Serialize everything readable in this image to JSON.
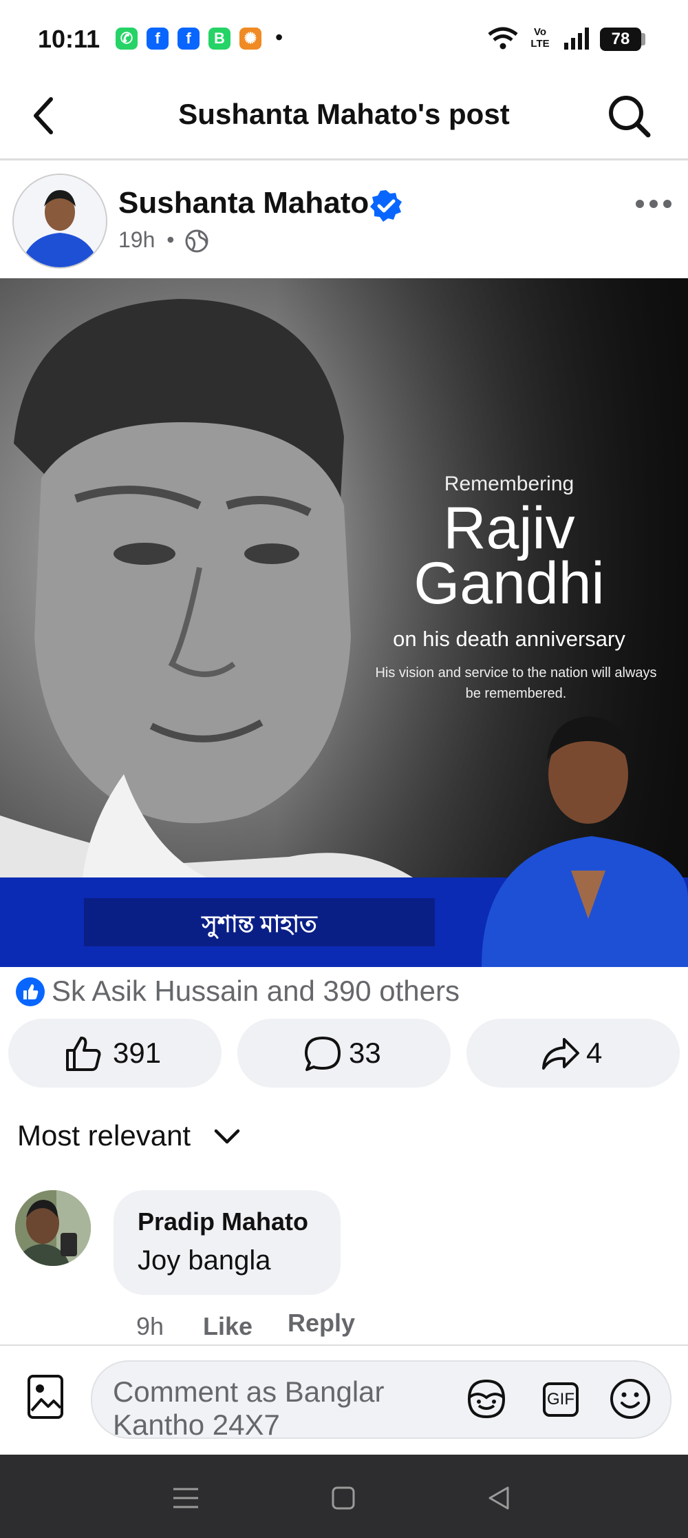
{
  "status_bar": {
    "time": "10:11",
    "dot": "•",
    "network_label": "Vo LTE",
    "battery": "78",
    "notif_icons": [
      "whatsapp-icon",
      "facebook-icon",
      "facebook-icon",
      "whatsapp-business-icon",
      "app-icon"
    ]
  },
  "header": {
    "title": "Sushanta Mahato's post"
  },
  "post": {
    "author": "Sushanta Mahato",
    "time": "19h",
    "dot": "•",
    "image": {
      "line1": "Remembering",
      "line2": "Rajiv",
      "line3": "Gandhi",
      "line4": "on his death anniversary",
      "line5": "His vision and service to the nation will always",
      "line6": "be remembered.",
      "banner_text": "সুশান্ত মাহাত"
    },
    "reactions_text": "Sk Asik Hussain and 390 others",
    "likes": "391",
    "comments": "33",
    "shares": "4"
  },
  "comments": {
    "sort_label": "Most relevant",
    "items": [
      {
        "name": "Pradip Mahato",
        "text": "Joy bangla",
        "time": "9h",
        "like": "Like",
        "reply": "Reply"
      }
    ]
  },
  "composer": {
    "placeholder": "Comment as Banglar Kantho 24X7",
    "gif_label": "GIF"
  },
  "colors": {
    "facebook_blue": "#0866ff",
    "whatsapp_green": "#25d366",
    "banner_blue": "#0b2bb5",
    "muted_text": "#65676b"
  }
}
